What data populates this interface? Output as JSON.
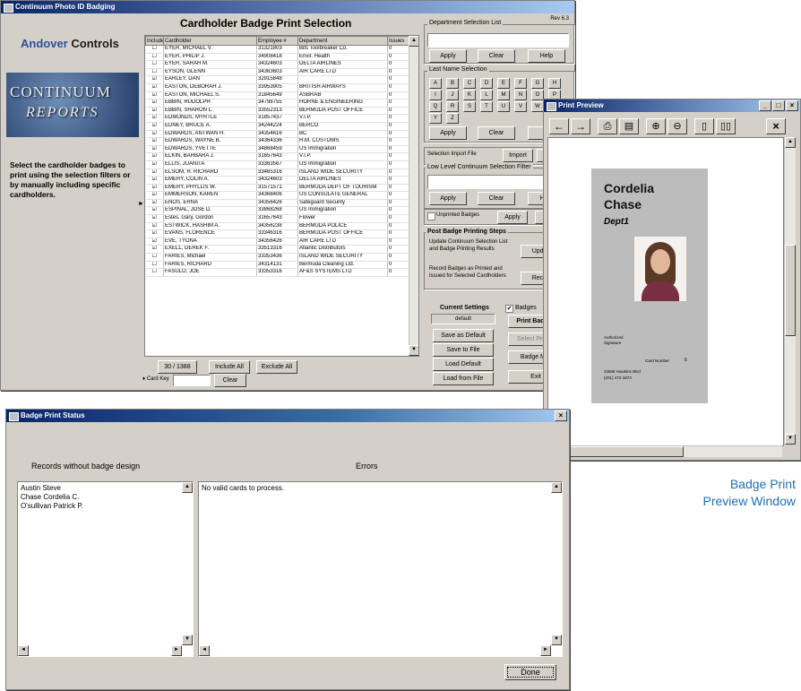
{
  "main_window": {
    "title": "Continuum Photo ID Badging",
    "version": "Rev 6.3",
    "heading": "Cardholder Badge Print Selection",
    "brand": {
      "left": "Andover",
      "right": "Controls"
    },
    "logo": {
      "line1": "CONTINUUM",
      "line2": "REPORTS"
    },
    "instructions": "Select the cardholder badges to print using the selection filters or by manually including specific cardholders.",
    "columns": [
      "Include",
      "Cardholder",
      "Employee #",
      "Department",
      "Issues"
    ],
    "rows": [
      {
        "checked": false,
        "name": "EYER, MICHAEL V.",
        "emp": "31321803",
        "dept": "Bits Toolbreaker Co.",
        "issues": "0"
      },
      {
        "checked": false,
        "name": "EYER, PHILIP J.",
        "emp": "34908418",
        "dept": "Envir. Health",
        "issues": "0"
      },
      {
        "checked": false,
        "name": "EYER, SARAH M.",
        "emp": "34324603",
        "dept": "DELTA AIRLINES",
        "issues": "0"
      },
      {
        "checked": false,
        "name": "EYSON, GLENN",
        "emp": "34363603",
        "dept": "AIR CARE LTD",
        "issues": "0"
      },
      {
        "checked": true,
        "name": "EARLEY, DAN",
        "emp": "32915848",
        "dept": "",
        "issues": "0"
      },
      {
        "checked": true,
        "name": "EASTON, DEBORAH J.",
        "emp": "33953905",
        "dept": "BRITISH AIRWAYS",
        "issues": "0"
      },
      {
        "checked": true,
        "name": "EASTON, MICHAEL S.",
        "emp": "31845649",
        "dept": "ASBRAB",
        "issues": "0"
      },
      {
        "checked": true,
        "name": "EBBIN, RUDOLPH",
        "emp": "34798755",
        "dept": "HORNE & ENGINEERING",
        "issues": "0"
      },
      {
        "checked": true,
        "name": "EBBIN, SHARON L.",
        "emp": "33552313",
        "dept": "BERMUDA POST OFFICE",
        "issues": "0"
      },
      {
        "checked": true,
        "name": "EDMONDS, MYRTLE",
        "emp": "31857437",
        "dept": "V.I.P.",
        "issues": "0"
      },
      {
        "checked": true,
        "name": "EDNEY, BRUCE A.",
        "emp": "34244224",
        "dept": "BERCO",
        "issues": "0"
      },
      {
        "checked": true,
        "name": "EDWARDS, ANTWAN H.",
        "emp": "34354616",
        "dept": "BC",
        "issues": "0"
      },
      {
        "checked": true,
        "name": "EDWARDS, WAYNE B.",
        "emp": "34364336",
        "dept": "H.M. CUSTOMS",
        "issues": "0"
      },
      {
        "checked": true,
        "name": "EDWARDS, YVETTE",
        "emp": "34868459",
        "dept": "US Immigration",
        "issues": "0"
      },
      {
        "checked": true,
        "name": "ELKIN, BARBARA J.",
        "emp": "31657643",
        "dept": "V.I.P.",
        "issues": "0"
      },
      {
        "checked": true,
        "name": "ELLIS, JUANITA",
        "emp": "33363567",
        "dept": "US Immigration",
        "issues": "0"
      },
      {
        "checked": true,
        "name": "ELSOM, H. RICHARD",
        "emp": "33465316",
        "dept": "ISLAND WIDE SECURITY",
        "issues": "0"
      },
      {
        "checked": true,
        "name": "EMERY, COLIN A.",
        "emp": "34324603",
        "dept": "DELTA AIRLINES",
        "issues": "0"
      },
      {
        "checked": true,
        "name": "EMERY, PHYLLIS W.",
        "emp": "31571571",
        "dept": "BERMUDA DEPT OF TOURISM",
        "issues": "0"
      },
      {
        "checked": true,
        "name": "EMMERSON, KAREN",
        "emp": "34368406",
        "dept": "US CONSULATE GENERAL",
        "issues": "0"
      },
      {
        "checked": true,
        "name": "ENOS, ERNA",
        "emp": "34356426",
        "dept": "Safeguard Security",
        "issues": "0"
      },
      {
        "checked": true,
        "name": "ESPINAL, JOSE D.",
        "emp": "33868268",
        "dept": "US Immigration",
        "issues": "0"
      },
      {
        "checked": true,
        "name": "Estes, Gary, Gordon",
        "emp": "31657643",
        "dept": "Flower",
        "issues": "0"
      },
      {
        "checked": true,
        "name": "ESTWICK, HASHIM A.",
        "emp": "34356238",
        "dept": "BERMUDA POLICE",
        "issues": "0"
      },
      {
        "checked": true,
        "name": "EVANS, FLORENCE",
        "emp": "33346316",
        "dept": "BERMUDA POST OFFICE",
        "issues": "0"
      },
      {
        "checked": true,
        "name": "EVE, TYONA",
        "emp": "34356426",
        "dept": "AIR CARE LTD",
        "issues": "0"
      },
      {
        "checked": true,
        "name": "EXELL, DEREK F.",
        "emp": "33513316",
        "dept": "Atlantic Distributors",
        "issues": "0"
      },
      {
        "checked": false,
        "name": "FARIES, Michael",
        "emp": "33353436",
        "dept": "ISLAND WIDE SECURITY",
        "issues": "0"
      },
      {
        "checked": false,
        "name": "FARIES, RICHARD",
        "emp": "34314131",
        "dept": "Bermuda Cleaning Ltd.",
        "issues": "0"
      },
      {
        "checked": false,
        "name": "FASULO, JOE",
        "emp": "33353316",
        "dept": "AF&S SYSTEMS LTD",
        "issues": "0"
      }
    ],
    "count": "30 / 1388",
    "include_all": "Include All",
    "exclude_all": "Exclude All",
    "card_key_label": "Card Key",
    "card_key_value": "",
    "card_clear": "Clear",
    "dept_filter": {
      "label": "Department Selection List",
      "apply": "Apply",
      "clear": "Clear",
      "help": "Help"
    },
    "lastname": {
      "label": "Last Name Selection",
      "letters": [
        "A",
        "B",
        "C",
        "D",
        "E",
        "F",
        "G",
        "H",
        "I",
        "J",
        "K",
        "L",
        "M",
        "N",
        "O",
        "P",
        "Q",
        "R",
        "S",
        "T",
        "U",
        "V",
        "W",
        "X",
        "Y",
        "Z"
      ],
      "apply": "Apply",
      "clear": "Clear",
      "all": "All"
    },
    "import": {
      "label": "Selection Import File",
      "import": "Import",
      "view": "View"
    },
    "lowlevel": {
      "label": "Low Level Continuum Selection Filter",
      "apply": "Apply",
      "clear": "Clear",
      "help": "Help"
    },
    "unprinted": {
      "label": "Unprinted Badges",
      "apply": "Apply",
      "clear": "Clear"
    },
    "post_print": {
      "label": "Post Badge Printing Steps",
      "update_text": "Update Continuum Selection List and Badge Printing Results",
      "update_btn": "Update",
      "record_text": "Record Badges as Printed and Issued for Selected Cardholders",
      "record_btn": "Record"
    },
    "settings": {
      "label": "Current Settings",
      "value": "default",
      "save_default": "Save as Default",
      "save_file": "Save to File",
      "load_default": "Load Default",
      "load_file": "Load from File",
      "badge_check": "Badges",
      "print_badges": "Print Badges",
      "select_printer": "Select Printer",
      "badge_mgr": "Badge Mgr",
      "exit": "Exit"
    }
  },
  "preview_window": {
    "title": "Print Preview",
    "name_first": "Cordelia",
    "name_last": "Chase",
    "dept": "Dept1",
    "sig_label": "Authorized Signature",
    "card_number_label": "Card Number",
    "card_number": "6",
    "small1": "34658 Hawkins Blvd",
    "small2": "(201) 472-1873",
    "caption_line1": "Badge Print",
    "caption_line2": "Preview Window"
  },
  "status_window": {
    "title": "Badge Print Status",
    "records_label": "Records without badge design",
    "records": [
      "Austin Steve",
      "Chase Cordelia C.",
      "O'sullivan Patrick P."
    ],
    "errors_label": "Errors",
    "errors_text": "No valid cards to process.",
    "done": "Done"
  },
  "colors": {
    "title_start": "#0a246a",
    "title_end": "#a6caf0",
    "face": "#d4d0c8",
    "brand_blue": "#2d4fa0",
    "caption": "#1f6fb5"
  }
}
